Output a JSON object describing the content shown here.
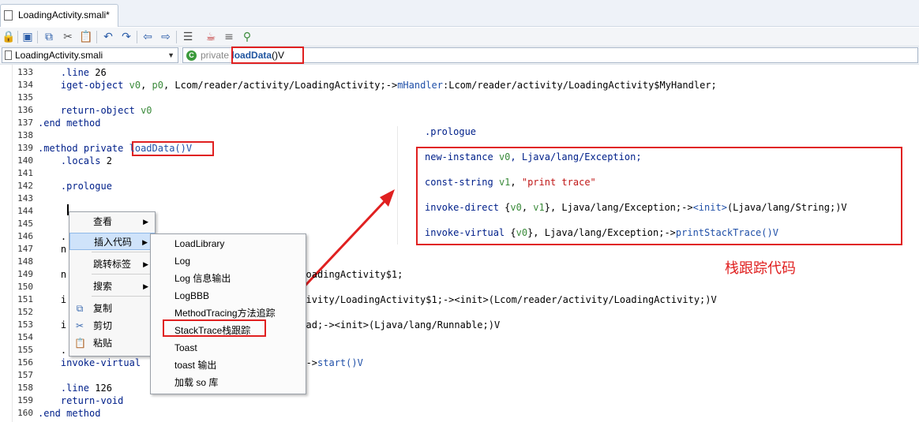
{
  "tab": {
    "title": "LoadingActivity.smali*"
  },
  "toolbar": {
    "icons": [
      "lock-icon",
      "save-icon",
      "copy-icon",
      "cut-icon",
      "paste-icon",
      "undo-icon",
      "redo-icon",
      "back-icon",
      "forward-icon",
      "format-icon",
      "java-icon",
      "list-icon",
      "debug-icon"
    ]
  },
  "address": {
    "file": "LoadingActivity.smali",
    "modifier": "private",
    "method_name": "loadData",
    "signature": "()V"
  },
  "editor": {
    "lines": [
      {
        "n": "133",
        "text": "    .line 26"
      },
      {
        "n": "134",
        "text": "    iget-object v0, p0, Lcom/reader/activity/LoadingActivity;->mHandler:Lcom/reader/activity/LoadingActivity$MyHandler;"
      },
      {
        "n": "135",
        "text": ""
      },
      {
        "n": "136",
        "text": "    return-object v0"
      },
      {
        "n": "137",
        "text": ".end method"
      },
      {
        "n": "138",
        "text": ""
      },
      {
        "n": "139",
        "text": ".method private loadData()V"
      },
      {
        "n": "140",
        "text": "    .locals 2"
      },
      {
        "n": "141",
        "text": ""
      },
      {
        "n": "142",
        "text": "    .prologue"
      },
      {
        "n": "143",
        "text": ""
      },
      {
        "n": "144",
        "text": ""
      },
      {
        "n": "145",
        "text": ""
      },
      {
        "n": "146",
        "text": "    ."
      },
      {
        "n": "147",
        "text": "    n"
      },
      {
        "n": "148",
        "text": ""
      },
      {
        "n": "149",
        "text": "    n                                          oadingActivity$1;"
      },
      {
        "n": "150",
        "text": ""
      },
      {
        "n": "151",
        "text": "    i                                          ivity/LoadingActivity$1;-><init>(Lcom/reader/activity/LoadingActivity;)V"
      },
      {
        "n": "152",
        "text": ""
      },
      {
        "n": "153",
        "text": "    i                                          ad;-><init>(Ljava/lang/Runnable;)V"
      },
      {
        "n": "154",
        "text": ""
      },
      {
        "n": "155",
        "text": "    ."
      },
      {
        "n": "156",
        "text": "    invoke-virtual                             ->start()V"
      },
      {
        "n": "157",
        "text": ""
      },
      {
        "n": "158",
        "text": "    .line 126"
      },
      {
        "n": "159",
        "text": "    return-void"
      },
      {
        "n": "160",
        "text": ".end method"
      }
    ]
  },
  "context_menu": {
    "items": [
      {
        "label": "查看",
        "has_sub": true
      },
      {
        "label": "插入代码",
        "has_sub": true
      },
      {
        "label": "跳转标签",
        "has_sub": true
      },
      {
        "label": "搜索",
        "has_sub": true
      },
      {
        "label": "复制",
        "icon": "copy-icon"
      },
      {
        "label": "剪切",
        "icon": "scissors-icon"
      },
      {
        "label": "粘贴",
        "icon": "paste-icon"
      }
    ]
  },
  "submenu": {
    "items": [
      "LoadLibrary",
      "Log",
      "Log 信息输出",
      "LogBBB",
      "MethodTracing方法追踪",
      "StackTrace栈跟踪",
      "Toast",
      "toast 输出",
      "加载 so 库"
    ]
  },
  "snippet": {
    "prologue": ".prologue",
    "lines": [
      "new-instance v0, Ljava/lang/Exception;",
      "const-string v1, \"print trace\"",
      "invoke-direct {v0, v1}, Ljava/lang/Exception;-><init>(Ljava/lang/String;)V",
      "invoke-virtual {v0}, Ljava/lang/Exception;->printStackTrace()V"
    ],
    "caption": "栈跟踪代码"
  },
  "colors": {
    "highlight_red": "#e02020",
    "menu_hover": "#cfe3fa"
  }
}
